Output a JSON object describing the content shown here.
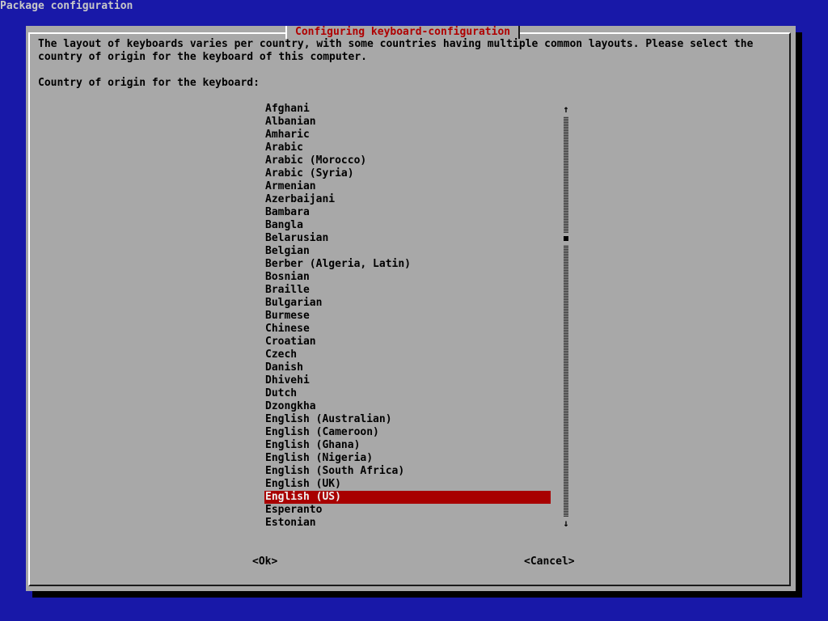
{
  "screen": {
    "title": "Package configuration"
  },
  "dialog": {
    "title": "Configuring keyboard-configuration",
    "description_lines": [
      "The layout of keyboards varies per country, with some countries having multiple common layouts. Please select the",
      "country of origin for the keyboard of this computer."
    ],
    "prompt": "Country of origin for the keyboard:",
    "list": {
      "items": [
        "Afghani",
        "Albanian",
        "Amharic",
        "Arabic",
        "Arabic (Morocco)",
        "Arabic (Syria)",
        "Armenian",
        "Azerbaijani",
        "Bambara",
        "Bangla",
        "Belarusian",
        "Belgian",
        "Berber (Algeria, Latin)",
        "Bosnian",
        "Braille",
        "Bulgarian",
        "Burmese",
        "Chinese",
        "Croatian",
        "Czech",
        "Danish",
        "Dhivehi",
        "Dutch",
        "Dzongkha",
        "English (Australian)",
        "English (Cameroon)",
        "English (Ghana)",
        "English (Nigeria)",
        "English (South Africa)",
        "English (UK)",
        "English (US)",
        "Esperanto",
        "Estonian"
      ],
      "selected": "English (US)"
    },
    "scrollbar": {
      "up_arrow": "↑",
      "down_arrow": "↓",
      "position_fraction": 0.31
    },
    "buttons": {
      "ok": "<Ok>",
      "cancel": "<Cancel>"
    }
  },
  "colors": {
    "background": "#1818a8",
    "dialog": "#a8a8a8",
    "title_text": "#b00000",
    "selection": "#a80000",
    "selection_text": "#f0f0f0"
  },
  "icons": {
    "scroll_up": "arrow-up-icon",
    "scroll_down": "arrow-down-icon",
    "scroll_thumb": "scroll-thumb"
  }
}
